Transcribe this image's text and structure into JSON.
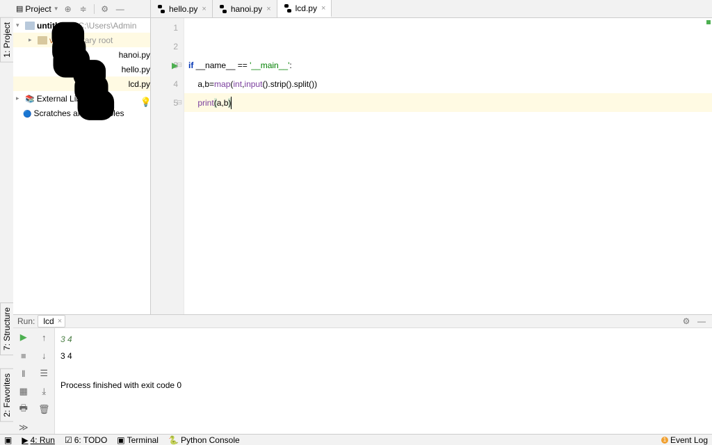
{
  "sidebar_tabs": {
    "project": "1: Project",
    "structure": "7: Structure",
    "favorites": "2: Favorites"
  },
  "project_header": {
    "label": "Project"
  },
  "tree": {
    "root": {
      "name": "untitled1",
      "path": "C:\\Users\\Admin"
    },
    "venv": {
      "name": "venv",
      "note": "library root"
    },
    "files": [
      "hanoi.py",
      "hello.py",
      "lcd.py"
    ],
    "external": "External Libraries",
    "scratches": "Scratches and Consoles"
  },
  "tabs": [
    {
      "name": "hello.py",
      "active": false
    },
    {
      "name": "hanoi.py",
      "active": false
    },
    {
      "name": "lcd.py",
      "active": true
    }
  ],
  "editor": {
    "lines": [
      1,
      2,
      3,
      4,
      5
    ],
    "code": {
      "l3": {
        "if": "if",
        "name": " __name__ ",
        "eq": "==",
        "str": " '__main__'",
        "colon": ":"
      },
      "l4": "    a,b=map(int,input().strip().split())",
      "l4p": {
        "pre": "    a,b=",
        "fn": "map",
        "mid": "(",
        "fn2": "int",
        "mid2": ",",
        "fn3": "input",
        "rest": "().strip().split())"
      },
      "l5": {
        "pre": "    ",
        "fn": "print",
        "open": "(",
        "args": "a,b",
        "close": ")"
      }
    }
  },
  "run": {
    "label": "Run:",
    "config": "lcd",
    "output": {
      "in": "3 4",
      "out": "3 4",
      "done": "Process finished with exit code 0"
    }
  },
  "status": {
    "run": "4: Run",
    "todo": "6: TODO",
    "terminal": "Terminal",
    "pyconsole": "Python Console",
    "eventlog": "Event Log",
    "badge": "1"
  }
}
